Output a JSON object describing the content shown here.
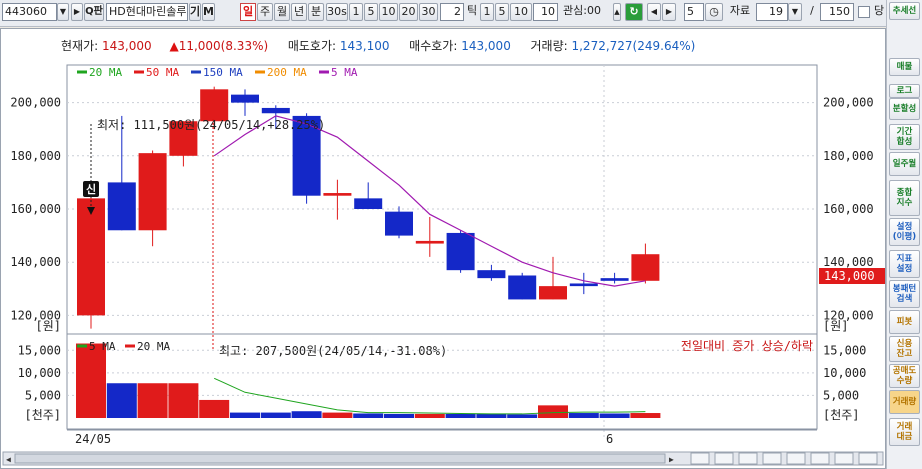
{
  "toolbar": {
    "stock_code": "443060",
    "stock_name": "HD현대마린솔루",
    "code_field_icon": "dropdown-arrow-icon",
    "label_gi": "기",
    "label_m": "M",
    "period_buttons": [
      "일",
      "주",
      "월",
      "년",
      "분"
    ],
    "interval_buttons": [
      "30s",
      "1",
      "5",
      "10",
      "20",
      "30"
    ],
    "tick_input_value": "2",
    "tick_label": "틱",
    "tick_buttons": [
      "1",
      "5",
      "10"
    ],
    "tick_value": "10",
    "interest_label": "관심:00",
    "step_value": "5",
    "data_label": "자료",
    "data_count_value": "19",
    "slash": "/",
    "total_value": "150",
    "last_label": "당"
  },
  "info": {
    "current_price_label": "현재가:",
    "current_price": "143,000",
    "change": "11,000(8.33%)",
    "ask_label": "매도호가:",
    "ask": "143,100",
    "bid_label": "매수호가:",
    "bid": "143,000",
    "volume_label": "거래량:",
    "volume": "1,272,727(249.64%)"
  },
  "legend_price": [
    {
      "name": "20 MA",
      "color": "#1fa51f"
    },
    {
      "name": "50 MA",
      "color": "#e01b1b"
    },
    {
      "name": "150 MA",
      "color": "#1f3fbf"
    },
    {
      "name": "200 MA",
      "color": "#f08c00"
    },
    {
      "name": "5 MA",
      "color": "#a01ab0"
    }
  ],
  "legend_volume": [
    {
      "name": "5 MA",
      "color": "#1fa51f"
    },
    {
      "name": "20 MA",
      "color": "#e01b1b"
    }
  ],
  "annotations": {
    "low": "최저: 111,500원(24/05/14,+28.25%)",
    "high": "최고: 207,500원(24/05/14,-31.08%)",
    "new_badge": "신",
    "volume_note": "전일대비 증가 상승/하락",
    "price_tag": "143,000"
  },
  "axes": {
    "price_ticks": [
      "200,000",
      "180,000",
      "160,000",
      "140,000",
      "120,000"
    ],
    "price_unit": "[원]",
    "volume_ticks": [
      "15,000",
      "10,000",
      "5,000"
    ],
    "volume_unit": "[천주]",
    "x_labels": [
      "24/05",
      "6"
    ]
  },
  "chart_data": [
    {
      "type": "candlestick",
      "title": "",
      "ylim": [
        113000,
        207000
      ],
      "y_ticks": [
        120000,
        140000,
        160000,
        180000,
        200000
      ],
      "candles": [
        {
          "open": 164000,
          "high": 165000,
          "low": 115000,
          "close": 120000,
          "color": "red"
        },
        {
          "open": 152000,
          "high": 195000,
          "low": 152000,
          "close": 170000,
          "color": "blue"
        },
        {
          "open": 152000,
          "high": 182000,
          "low": 146000,
          "close": 181000,
          "color": "red"
        },
        {
          "open": 180000,
          "high": 193000,
          "low": 176000,
          "close": 193000,
          "color": "red"
        },
        {
          "open": 193000,
          "high": 206000,
          "low": 190000,
          "close": 205000,
          "color": "red"
        },
        {
          "open": 203000,
          "high": 205000,
          "low": 195000,
          "close": 200000,
          "color": "blue"
        },
        {
          "open": 198000,
          "high": 199000,
          "low": 190000,
          "close": 196000,
          "color": "blue"
        },
        {
          "open": 195000,
          "high": 196000,
          "low": 162000,
          "close": 165000,
          "color": "blue"
        },
        {
          "open": 166000,
          "high": 171000,
          "low": 156000,
          "close": 165000,
          "color": "red"
        },
        {
          "open": 164000,
          "high": 170000,
          "low": 160000,
          "close": 160000,
          "color": "blue"
        },
        {
          "open": 159000,
          "high": 161000,
          "low": 149000,
          "close": 150000,
          "color": "blue"
        },
        {
          "open": 148000,
          "high": 157000,
          "low": 142000,
          "close": 147000,
          "color": "red"
        },
        {
          "open": 151000,
          "high": 152000,
          "low": 136000,
          "close": 137000,
          "color": "blue"
        },
        {
          "open": 137000,
          "high": 139000,
          "low": 133000,
          "close": 134000,
          "color": "blue"
        },
        {
          "open": 135000,
          "high": 136000,
          "low": 126000,
          "close": 126000,
          "color": "blue"
        },
        {
          "open": 126000,
          "high": 142000,
          "low": 126000,
          "close": 131000,
          "color": "red"
        },
        {
          "open": 131000,
          "high": 136000,
          "low": 128000,
          "close": 132000,
          "color": "blue"
        },
        {
          "open": 133000,
          "high": 136000,
          "low": 132000,
          "close": 134000,
          "color": "blue"
        },
        {
          "open": 133000,
          "high": 147000,
          "low": 132000,
          "close": 143000,
          "color": "red"
        }
      ],
      "ma5": [
        null,
        null,
        null,
        null,
        180000,
        188000,
        195000,
        192000,
        187000,
        178000,
        169000,
        158000,
        152000,
        146000,
        140000,
        136000,
        133000,
        131000,
        133000
      ]
    },
    {
      "type": "bar",
      "title": "",
      "ylim": [
        0,
        17500
      ],
      "y_ticks": [
        5000,
        10000,
        15000
      ],
      "values": [
        16500,
        7700,
        7700,
        7700,
        4000,
        1200,
        1200,
        1500,
        1200,
        1000,
        900,
        900,
        900,
        900,
        800,
        2800,
        1100,
        1000,
        1100
      ],
      "colors": [
        "red",
        "blue",
        "red",
        "red",
        "red",
        "blue",
        "blue",
        "blue",
        "red",
        "blue",
        "blue",
        "red",
        "blue",
        "blue",
        "blue",
        "red",
        "blue",
        "blue",
        "red"
      ],
      "ma5": [
        null,
        null,
        null,
        null,
        8800,
        5700,
        4400,
        3100,
        1800,
        1200,
        1200,
        1100,
        1000,
        900,
        900,
        1200,
        1300,
        1300,
        1400
      ]
    }
  ],
  "sidebar": {
    "items": [
      "추세선",
      "매물",
      "로그",
      "분할성",
      "기간\n합성",
      "일주월",
      "종합\n지수",
      "설정\n(이평)",
      "지표\n설정",
      "봉패턴\n검색",
      "피봇",
      "신용\n잔고",
      "공매도\n수량",
      "거래량",
      "거래\n대금"
    ]
  },
  "colors": {
    "up": "#e01b1b",
    "down": "#1428c8",
    "ma5_price": "#a01ab0",
    "ma5_volume": "#1fa51f",
    "grid": "#c9ced6"
  }
}
